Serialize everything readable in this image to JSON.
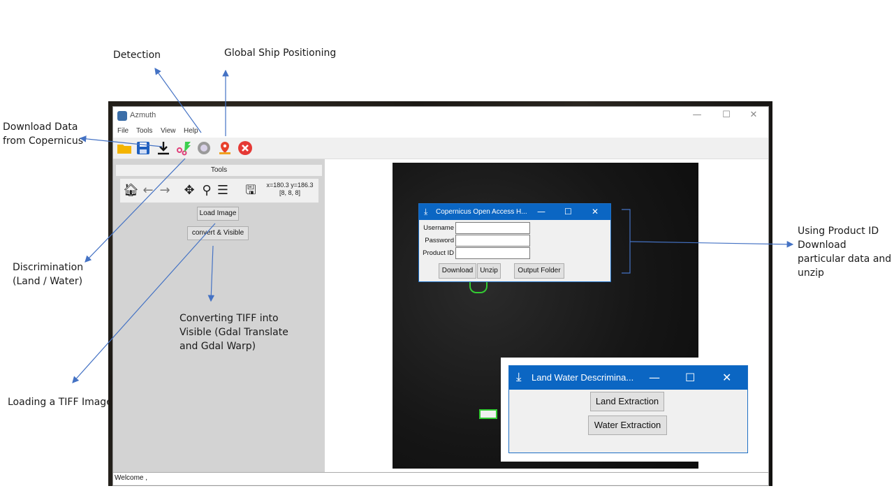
{
  "annotations": {
    "detection": "Detection",
    "global_ship_positioning": "Global Ship Positioning",
    "download_data": "Download Data\nfrom Copernicus",
    "discrimination": "Discrimination\n(Land / Water)",
    "loading_tiff": "Loading a TIFF Image",
    "converting_tiff": "Converting TIFF into\nVisible (Gdal Translate\nand Gdal Warp)",
    "using_product_id": "Using Product ID\nDownload\nparticular data and\nunzip"
  },
  "app": {
    "title": "Azmuth",
    "window_controls": {
      "minimize": "—",
      "maximize": "☐",
      "close": "✕"
    },
    "menu": [
      "File",
      "Tools",
      "View",
      "Help"
    ],
    "toolbar_icons": [
      "folder-icon",
      "save-icon",
      "download-icon",
      "detection-icon",
      "discrimination-icon",
      "location-pin-icon",
      "close-icon"
    ],
    "tools_panel": {
      "header": "Tools",
      "coords_line1": "x=180.3 y=186.3",
      "coords_line2": "[8, 8, 8]",
      "load_image": "Load Image",
      "convert_visible": "convert & Visible"
    },
    "status": "Welcome ,"
  },
  "copernicus_dialog": {
    "title": "Copernicus Open Access H...",
    "labels": {
      "username": "Username",
      "password": "Password",
      "product_id": "Product ID"
    },
    "values": {
      "username": "",
      "password": "",
      "product_id": ""
    },
    "buttons": {
      "download": "Download",
      "unzip": "Unzip",
      "output_folder": "Output Folder"
    }
  },
  "land_water_dialog": {
    "title": "Land Water Descrimina...",
    "buttons": {
      "land": "Land Extraction",
      "water": "Water Extraction"
    }
  },
  "colors": {
    "accent": "#0b66c3",
    "annotation_arrow": "#4472c4",
    "detection_box": "#33cc33"
  }
}
